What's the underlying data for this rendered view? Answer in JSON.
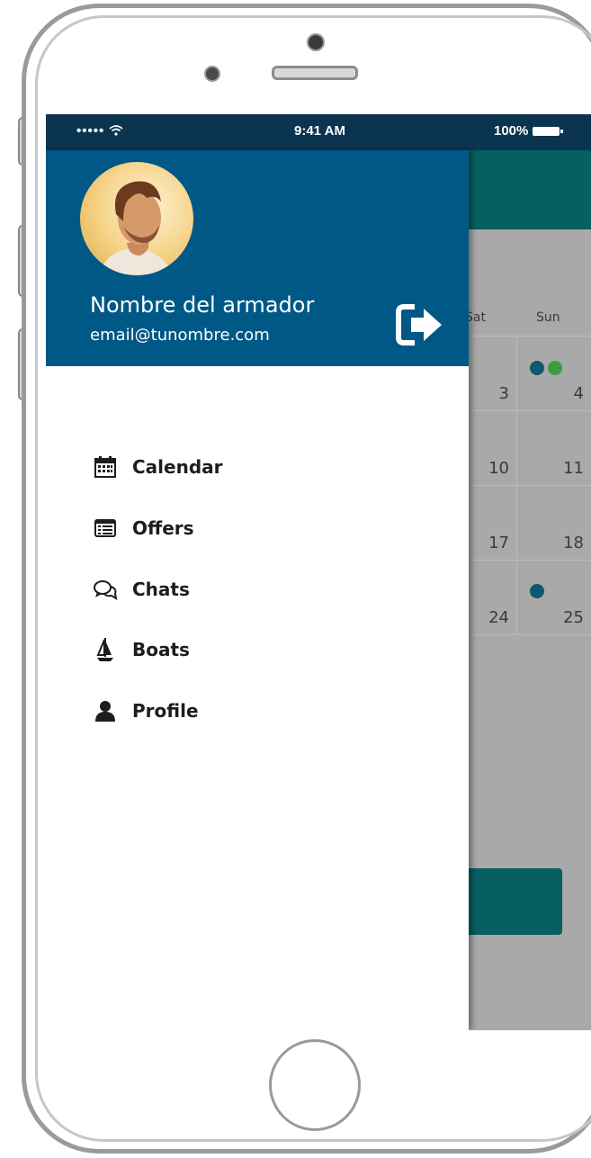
{
  "status_bar": {
    "signal": "••••• ",
    "time": "9:41 AM",
    "battery": "100%"
  },
  "drawer": {
    "user_name": "Nombre del armador",
    "user_email": "email@tunombre.com",
    "menu": [
      {
        "label": "Calendar",
        "icon": "calendar-icon"
      },
      {
        "label": "Offers",
        "icon": "list-icon"
      },
      {
        "label": "Chats",
        "icon": "chat-bubbles-icon"
      },
      {
        "label": "Boats",
        "icon": "sailboat-icon"
      },
      {
        "label": "Profile",
        "icon": "user-icon"
      }
    ]
  },
  "background_calendar": {
    "day_headers": [
      "Sat",
      "Sun"
    ],
    "rows": [
      {
        "sat": "3",
        "sun": "4"
      },
      {
        "sat": "10",
        "sun": "11"
      },
      {
        "sat": "17",
        "sun": "18"
      },
      {
        "sat": "24",
        "sun": "25"
      }
    ],
    "colors": {
      "teal": "#065f60",
      "dot_blue": "#0c5a6b",
      "dot_green": "#3a9b3f"
    }
  },
  "colors": {
    "drawer_header": "#005886",
    "status_bar": "#0a3450"
  }
}
